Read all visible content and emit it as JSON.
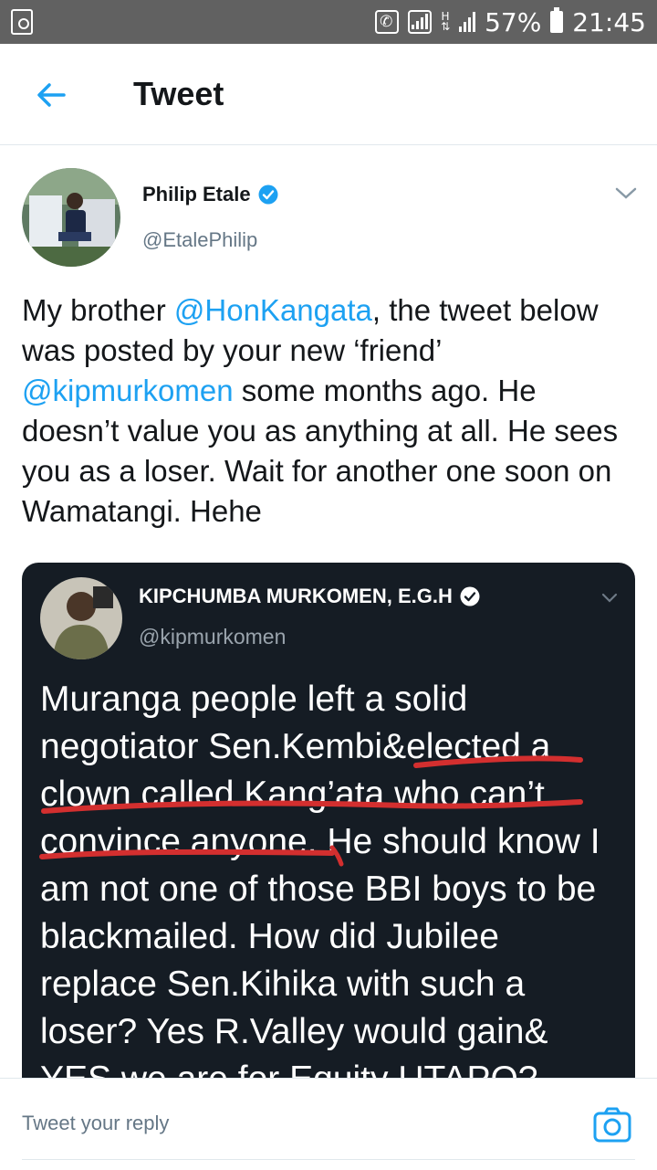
{
  "status_bar": {
    "battery_percent": "57%",
    "time": "21:45",
    "network_letter": "H"
  },
  "header": {
    "title": "Tweet"
  },
  "tweet": {
    "author_name": "Philip Etale",
    "author_handle": "@EtalePhilip",
    "text_parts": {
      "p1": "My brother ",
      "m1": "@HonKangata",
      "p2": ", the tweet below was posted by your new ‘friend’ ",
      "m2": "@kipmurkomen",
      "p3": " some months ago. He doesn’t value you as anything at all. He sees you as a loser. Wait for another one soon on Wamatangi. Hehe"
    }
  },
  "embedded_tweet": {
    "author_name": "KIPCHUMBA MURKOMEN, E.G.H",
    "author_handle": "@kipmurkomen",
    "text": "Muranga people left a solid negotiator Sen.Kembi&elected a clown called Kang’ata who can’t convince anyone. He should know I am not one of those BBI boys to be blackmailed. How did Jubilee replace Sen.Kihika with such a loser? Yes R.Valley would gain& YES we are for Equity UTAPO?"
  },
  "reply": {
    "placeholder": "Tweet your reply"
  },
  "colors": {
    "accent": "#1da1f2",
    "status_bar": "#616161",
    "embed_bg": "#151c24",
    "annotation_red": "#d32f2f"
  }
}
